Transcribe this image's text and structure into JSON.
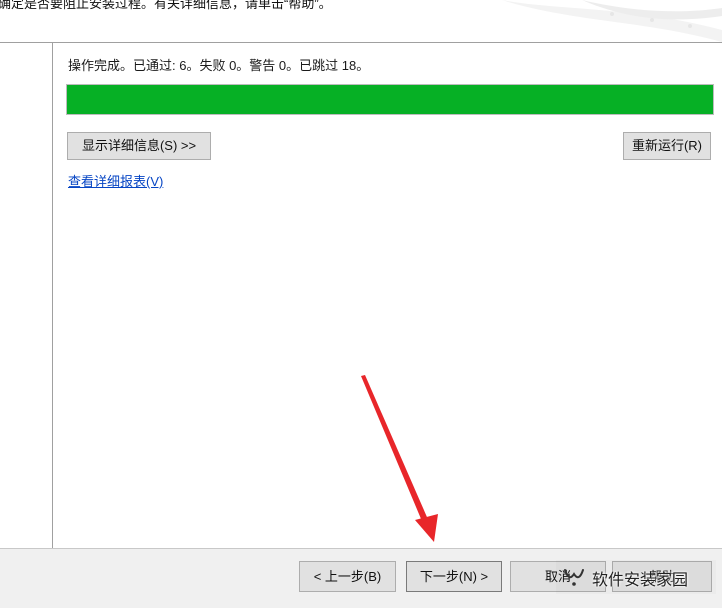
{
  "header": {
    "instruction_text": "确定是否要阻止安装过程。有关详细信息，请单击“帮助”。"
  },
  "status": {
    "summary": "操作完成。已通过: 6。失败 0。警告 0。已跳过 18。",
    "progress_fraction": 1.0
  },
  "buttons": {
    "show_details": "显示详细信息(S) >>",
    "rerun": "重新运行(R)",
    "back": "< 上一步(B)",
    "next": "下一步(N) >",
    "cancel": "取消",
    "help": "帮助"
  },
  "links": {
    "view_report": "查看详细报表(V)"
  },
  "watermark": {
    "text": "软件安装家园"
  },
  "colors": {
    "progress_fill": "#06b025",
    "link": "#0645c4",
    "annotation_arrow": "#e8262a"
  },
  "icons": {
    "watermark": "wechat-channel-icon"
  }
}
